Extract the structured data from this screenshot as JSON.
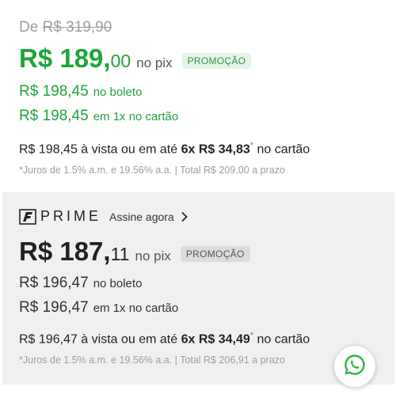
{
  "standard": {
    "old_prefix": "De",
    "old_price": "R$ 319,90",
    "pix_price_main": "R$ 189,",
    "pix_price_cents": "00",
    "pix_label": "no pix",
    "promo_badge": "PROMOÇÃO",
    "boleto_price": "R$  198,45",
    "boleto_label": "no boleto",
    "card1x_price": "R$  198,45",
    "card1x_label": "em 1x no cartão",
    "installments": {
      "prefix": "R$ 198,45",
      "middle": " à vista ou em até ",
      "plan": "6x R$ 34,83",
      "asterisk": "*",
      "suffix": " no cartão"
    },
    "juros_note": "*Juros de 1.5% a.m. e 19.56% a.a. | Total R$ 209,00 a prazo"
  },
  "prime": {
    "brand": "PRIME",
    "subscribe_link": "Assine agora",
    "pix_price_main": "R$ 187,",
    "pix_price_cents": "11",
    "pix_label": "no pix",
    "promo_badge": "PROMOÇÃO",
    "boleto_price": "R$  196,47",
    "boleto_label": "no boleto",
    "card1x_price": "R$  196,47",
    "card1x_label": "em 1x no cartão",
    "installments": {
      "prefix": "R$ 196,47",
      "middle": " à vista ou em até ",
      "plan": "6x R$ 34,49",
      "asterisk": "*",
      "suffix": " no cartão"
    },
    "juros_note": "*Juros de 1.5% a.m. e 19.56% a.a. | Total R$ 206,91 a prazo"
  },
  "colors": {
    "accent_green": "#1ea53a",
    "prime_background": "#f0f0f0",
    "whatsapp_green": "#2bb741"
  },
  "icons": {
    "prime_logo": "prime-logo-icon",
    "chevron": "chevron-right-icon",
    "whatsapp": "whatsapp-icon"
  }
}
